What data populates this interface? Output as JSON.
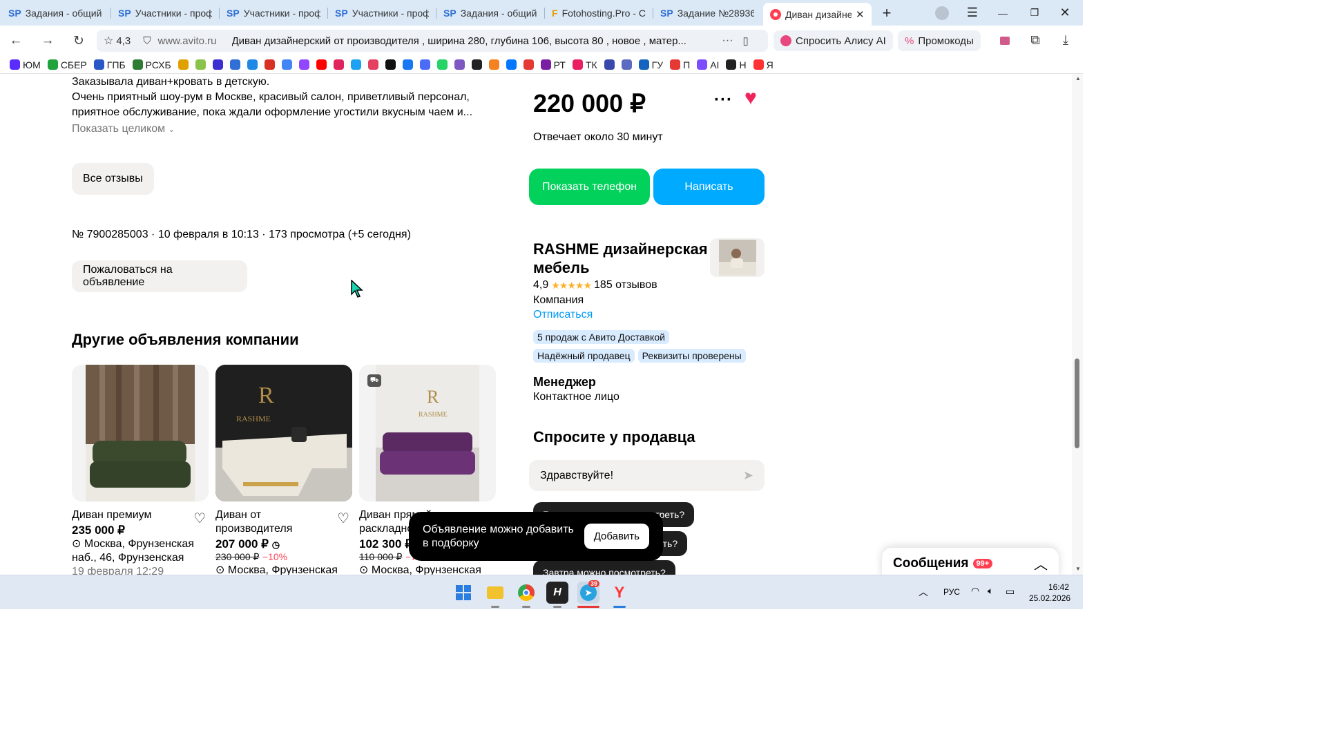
{
  "tabs": [
    {
      "icon": "SP",
      "title": "Задания - общий с"
    },
    {
      "icon": "SP",
      "title": "Участники - проф"
    },
    {
      "icon": "SP",
      "title": "Участники - проф"
    },
    {
      "icon": "SP",
      "title": "Участники - проф"
    },
    {
      "icon": "SP",
      "title": "Задания - общий с"
    },
    {
      "icon": "F",
      "title": "Fotohosting.Pro - С"
    },
    {
      "icon": "SP",
      "title": "Задание №28936:"
    },
    {
      "icon": "",
      "title": "Диван дизайне"
    }
  ],
  "address": {
    "rating": "4,3",
    "domain": "www.avito.ru",
    "page_title": "Диван дизайнерский от производителя , ширина 280, глубина 106, высота 80 , новое , матер...",
    "alice": "Спросить Алису AI",
    "promo": "Промокоды"
  },
  "bookmarks": [
    {
      "label": "ЮМ",
      "color": "#5b2cff"
    },
    {
      "label": "СБЕР",
      "color": "#1fa33a"
    },
    {
      "label": "ГПБ",
      "color": "#2a56c6"
    },
    {
      "label": "РСХБ",
      "color": "#2e7d32"
    },
    {
      "label": "",
      "color": "#e0a000"
    },
    {
      "label": "",
      "color": "#8bc34a"
    },
    {
      "label": "",
      "color": "#3b2fd0"
    },
    {
      "label": "",
      "color": "#2f6fd6"
    },
    {
      "label": "",
      "color": "#1e88e5"
    },
    {
      "label": "",
      "color": "#d93025"
    },
    {
      "label": "",
      "color": "#4285f4"
    },
    {
      "label": "",
      "color": "#9146ff"
    },
    {
      "label": "",
      "color": "#ff0000"
    },
    {
      "label": "",
      "color": "#e0245e"
    },
    {
      "label": "",
      "color": "#1da1f2"
    },
    {
      "label": "",
      "color": "#e4405f"
    },
    {
      "label": "",
      "color": "#111111"
    },
    {
      "label": "",
      "color": "#1877f2"
    },
    {
      "label": "",
      "color": "#4a6cf7"
    },
    {
      "label": "",
      "color": "#25d366"
    },
    {
      "label": "",
      "color": "#7e57c2"
    },
    {
      "label": "",
      "color": "#222222"
    },
    {
      "label": "",
      "color": "#f58220"
    },
    {
      "label": "",
      "color": "#0077ff"
    },
    {
      "label": "",
      "color": "#e53935"
    },
    {
      "label": "РТ",
      "color": "#7b1fa2"
    },
    {
      "label": "ТК",
      "color": "#e91e63"
    },
    {
      "label": "",
      "color": "#3949ab"
    },
    {
      "label": "",
      "color": "#5c6bc0"
    },
    {
      "label": "ГУ",
      "color": "#1565c0"
    },
    {
      "label": "П",
      "color": "#e53935"
    },
    {
      "label": "AI",
      "color": "#7c4dff"
    },
    {
      "label": "Н",
      "color": "#222222"
    },
    {
      "label": "Я",
      "color": "#ff3333"
    }
  ],
  "review": {
    "line1": "Заказывала диван+кровать в детскую.",
    "line2": "Очень приятный шоу-рум в Москве, красивый салон, приветливый персонал,",
    "line3": "приятное обслуживание, пока ждали оформление угостили вкусным чаем и...",
    "show_full": "Показать целиком"
  },
  "all_reviews": "Все отзывы",
  "listing_meta": "№ 7900285003 · 10 февраля в 10:13 · 173 просмотра (+5 сегодня)",
  "report": "Пожаловаться на объявление",
  "other_title": "Другие объявления компании",
  "cards": [
    {
      "title": "Диван премиум",
      "price": "235 000 ₽",
      "loc": "Москва, Фрунзенская наб., 46, Фрунзенская",
      "date": "19 февраля 12:29"
    },
    {
      "title": "Диван от производителя",
      "price": "207 000 ₽",
      "old": "230 000 ₽",
      "off": "−10%",
      "loc": "Москва, Фрунзенская"
    },
    {
      "title": "Диван прямой раскладной",
      "price": "102 300 ₽",
      "old": "110 000 ₽",
      "off": "−7%",
      "loc": "Москва, Фрунзенская"
    }
  ],
  "price": "220 000 ₽",
  "response": "Отвечает около 30 минут",
  "show_phone": "Показать телефон",
  "write": "Написать",
  "seller": {
    "name": "RASHME дизайнерская мебель",
    "rating": "4,9",
    "reviews": "185 отзывов",
    "type": "Компания",
    "unsubscribe": "Отписаться",
    "chips1": [
      "5 продаж с Авито Доставкой"
    ],
    "chips2": [
      "Надёжный продавец",
      "Реквизиты проверены"
    ]
  },
  "manager": {
    "title": "Менеджер",
    "sub": "Контактное лицо"
  },
  "ask": {
    "title": "Спросите у продавца",
    "input": "Здравствуйте!",
    "q1": "Где и когда можно посмотреть?",
    "q2": "Торг уместен? Можно купить?",
    "q3": "Завтра можно посмотреть?"
  },
  "toast": {
    "text": "Объявление можно добавить в подборку",
    "button": "Добавить"
  },
  "messages": {
    "label": "Сообщения",
    "badge": "99+"
  },
  "system": {
    "lang": "РУС",
    "time": "16:42",
    "date": "25.02.2026",
    "telegram_badge": "39"
  }
}
